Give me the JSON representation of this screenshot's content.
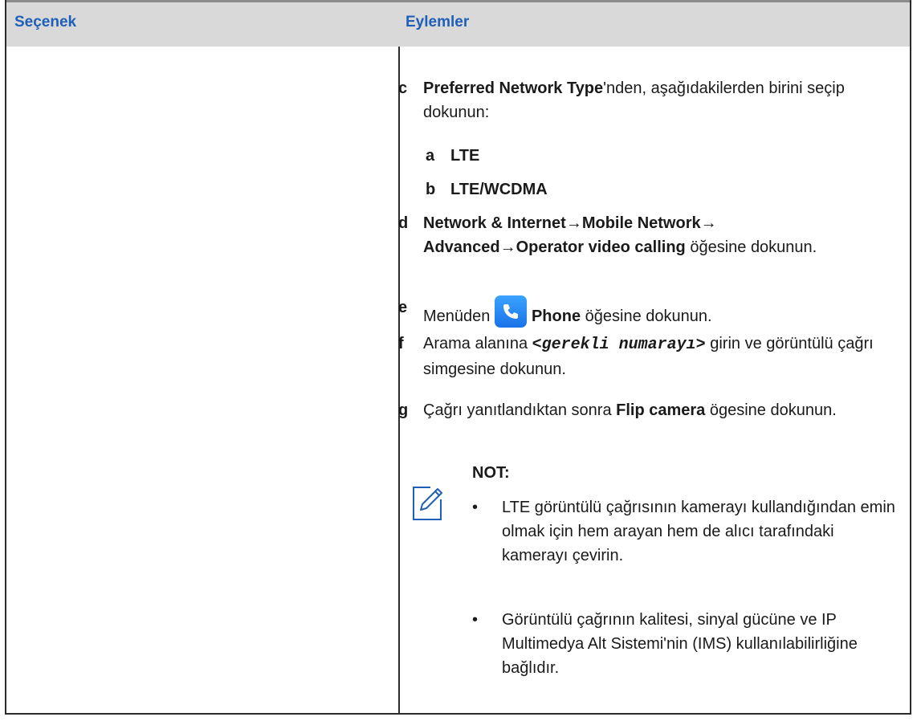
{
  "header": {
    "col1": "Seçenek",
    "col2": "Eylemler"
  },
  "steps": [
    {
      "letter": "c",
      "bold": "Preferred Network Type",
      "rest": "'nden, aşağıdakilerden birini seçip dokunun:"
    },
    {
      "letter": "d",
      "b1": "Network & Internet",
      "arrow1": "→",
      "b2": "Mobile Network",
      "arrow2": "→",
      "b3": "Advanced",
      "arrow3": "→",
      "b4": "Operator video calling",
      "rest": " öğesine dokunun."
    },
    {
      "letter": "e",
      "pre": "Menüden ",
      "bold": "Phone",
      "rest": " öğesine dokunun.",
      "icon": "phone-app-icon"
    },
    {
      "letter": "f",
      "pre": "Arama alanına ",
      "code": "<gerekli numarayı>",
      "rest": " girin ve görüntülü çağrı simgesine dokunun."
    },
    {
      "letter": "g",
      "pre": "Çağrı yanıtlandıktan sonra ",
      "bold": "Flip camera",
      "rest": " ögesine dokunun."
    }
  ],
  "substeps": [
    {
      "letter": "a",
      "text": "LTE"
    },
    {
      "letter": "b",
      "text": "LTE/WCDMA"
    }
  ],
  "note": {
    "title": "NOT:",
    "icon": "note-pencil-icon",
    "bullets": [
      "LTE görüntülü çağrısının kamerayı kullandığından emin olmak için hem arayan hem de alıcı tarafındaki kamerayı çevirin.",
      "Görüntülü çağrının kalitesi, sinyal gücüne ve IP Multimedya Alt Sistemi'nin (IMS) kullanılabilirliğine bağlıdır."
    ]
  },
  "colors": {
    "header_text": "#1f5fb8",
    "header_bg": "#d9d9d9",
    "icon_blue": "#1a72e8"
  }
}
